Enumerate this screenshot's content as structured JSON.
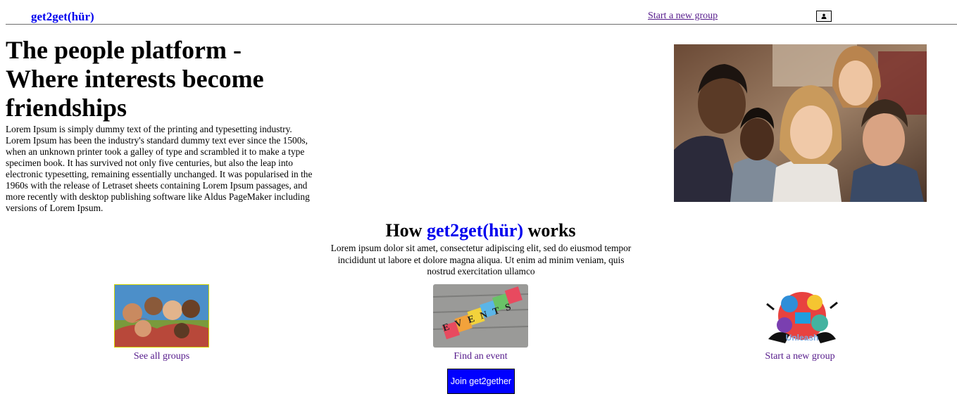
{
  "header": {
    "brand": "get2get(hür)",
    "start_group_link": "Start a new group",
    "user_icon": "user-icon"
  },
  "hero": {
    "title": "The people platform - Where interests become friendships",
    "body": "Lorem Ipsum is simply dummy text of the printing and typesetting industry. Lorem Ipsum has been the industry's standard dummy text ever since the 1500s, when an unknown printer took a galley of type and scrambled it to make a type specimen book. It has survived not only five centuries, but also the leap into electronic typesetting, remaining essentially unchanged. It was popularised in the 1960s with the release of Letraset sheets containing Lorem Ipsum passages, and more recently with desktop publishing software like Aldus PageMaker including versions of Lorem Ipsum."
  },
  "how": {
    "title_prefix": "How ",
    "title_brand": "get2get(hür)",
    "title_suffix": " works",
    "body": "Lorem ipsum dolor sit amet, consectetur adipiscing elit, sed do eiusmod tempor incididunt ut labore et dolore magna aliqua. Ut enim ad minim veniam, quis nostrud exercitation ullamco"
  },
  "cards": {
    "groups_link": "See all groups",
    "events_link": "Find an event",
    "events_blocks": "EVENTS",
    "start_link": "Start a new group",
    "start_logo_text": "Unleash"
  },
  "join_button": "Join get2gether",
  "colors": {
    "brand_blue": "#0000ee",
    "button_blue": "#0000ff",
    "visited_link": "#551a8b"
  }
}
